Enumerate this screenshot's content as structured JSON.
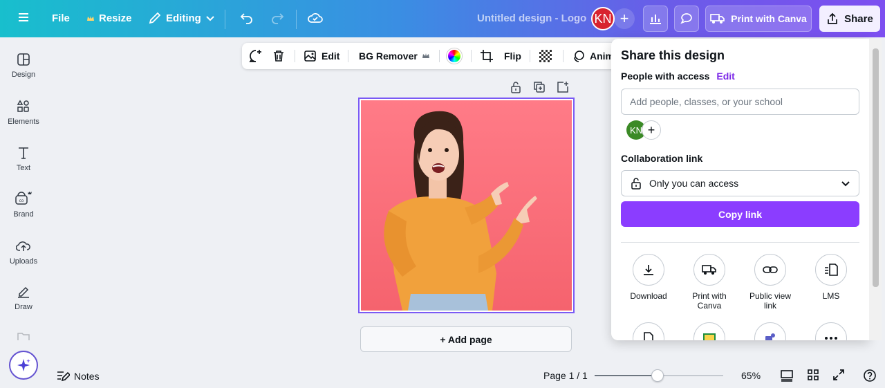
{
  "topbar": {
    "file_label": "File",
    "resize_label": "Resize",
    "editing_label": "Editing",
    "design_title": "Untitled design - Logo",
    "avatar_initials": "KN",
    "print_label": "Print with Canva",
    "share_label": "Share"
  },
  "sidebar": {
    "items": [
      {
        "label": "Design"
      },
      {
        "label": "Elements"
      },
      {
        "label": "Text"
      },
      {
        "label": "Brand"
      },
      {
        "label": "Uploads"
      },
      {
        "label": "Draw"
      }
    ]
  },
  "context_toolbar": {
    "edit_label": "Edit",
    "bg_remover_label": "BG Remover",
    "flip_label": "Flip",
    "animate_label": "Anim"
  },
  "canvas": {
    "add_page_label": "+ Add page"
  },
  "footer": {
    "notes_label": "Notes",
    "page_indicator": "Page 1 / 1",
    "zoom_value": "65%",
    "zoom_fraction": 0.49
  },
  "share_panel": {
    "title": "Share this design",
    "people_label": "People with access",
    "edit_label": "Edit",
    "input_placeholder": "Add people, classes, or your school",
    "member_initials": "KN",
    "collab_label": "Collaboration link",
    "access_value": "Only you can access",
    "copy_label": "Copy link",
    "options": [
      {
        "label": "Download",
        "icon": "download-icon"
      },
      {
        "label": "Print with Canva",
        "icon": "truck-icon"
      },
      {
        "label": "Public view link",
        "icon": "link-icon"
      },
      {
        "label": "LMS",
        "icon": "lms-icon"
      }
    ]
  },
  "colors": {
    "accent": "#8b3dff",
    "canvas_bg": "#ff7b87",
    "avatar_red": "#d8232f"
  }
}
